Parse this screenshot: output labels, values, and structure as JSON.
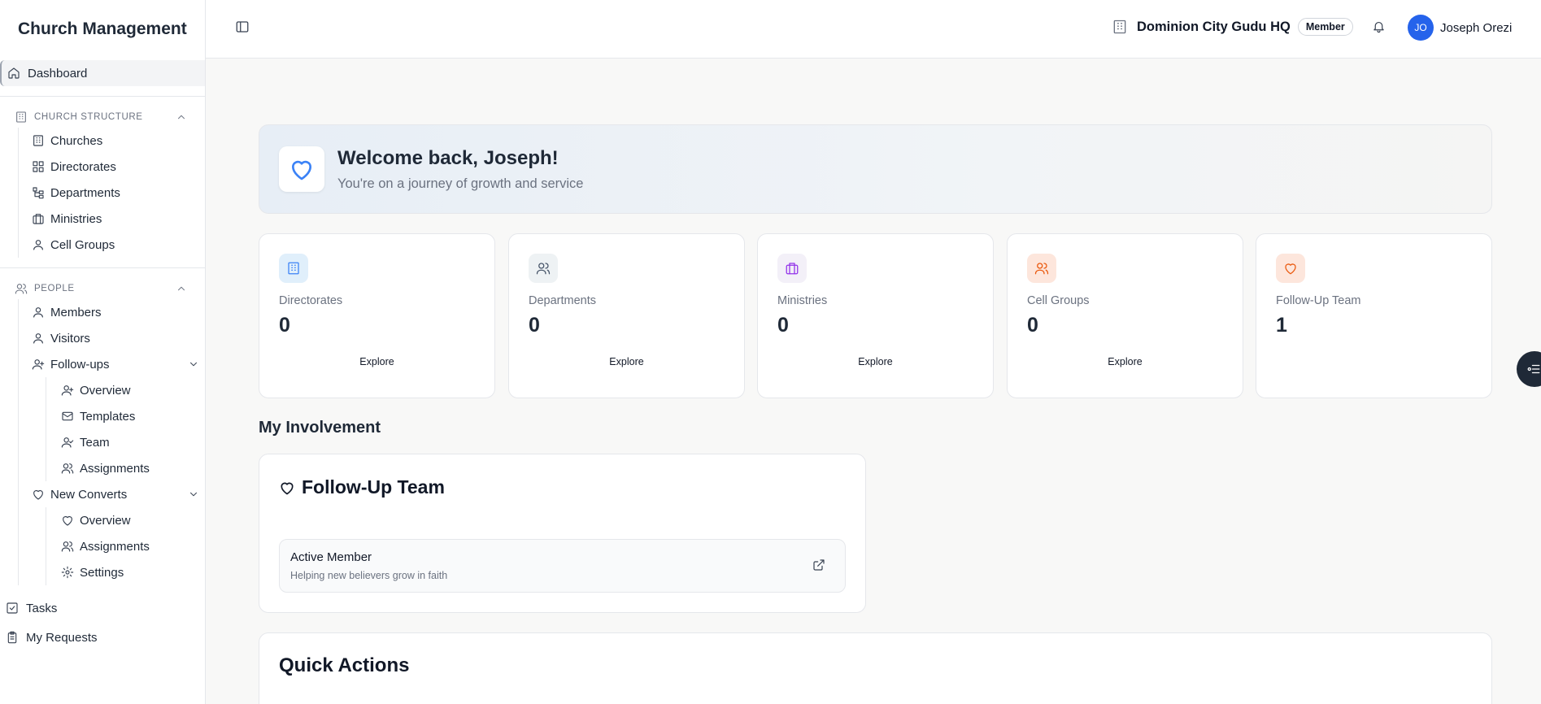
{
  "app": {
    "title": "Church Management"
  },
  "sidebar": {
    "dashboard": "Dashboard",
    "church_structure": {
      "heading": "CHURCH STRUCTURE",
      "items": [
        "Churches",
        "Directorates",
        "Departments",
        "Ministries",
        "Cell Groups"
      ]
    },
    "people": {
      "heading": "PEOPLE",
      "members": "Members",
      "visitors": "Visitors",
      "followups": {
        "label": "Follow-ups",
        "items": [
          "Overview",
          "Templates",
          "Team",
          "Assignments"
        ]
      },
      "new_converts": {
        "label": "New Converts",
        "items": [
          "Overview",
          "Assignments",
          "Settings"
        ]
      }
    },
    "tasks": "Tasks",
    "my_requests": "My Requests"
  },
  "header": {
    "church_name": "Dominion City Gudu HQ",
    "role_badge": "Member",
    "user_initials": "JO",
    "user_name": "Joseph Orezi"
  },
  "welcome": {
    "title": "Welcome back, Joseph!",
    "subtitle": "You're on a journey of growth and service"
  },
  "stats": [
    {
      "label": "Directorates",
      "value": "0",
      "action": "Explore",
      "color": "#3b82f6",
      "bg": "#e0effb",
      "icon": "building-icon"
    },
    {
      "label": "Departments",
      "value": "0",
      "action": "Explore",
      "color": "#475569",
      "bg": "#eef2f4",
      "icon": "users-icon"
    },
    {
      "label": "Ministries",
      "value": "0",
      "action": "Explore",
      "color": "#9333ea",
      "bg": "#f3f0f8",
      "icon": "briefcase-icon"
    },
    {
      "label": "Cell Groups",
      "value": "0",
      "action": "Explore",
      "color": "#ea580c",
      "bg": "#fde6dc",
      "icon": "users-icon"
    },
    {
      "label": "Follow-Up Team",
      "value": "1",
      "action": "",
      "color": "#ea580c",
      "bg": "#fde6dc",
      "icon": "heart-icon"
    }
  ],
  "involvement": {
    "heading": "My Involvement",
    "team_name": "Follow-Up Team",
    "member_title": "Active Member",
    "member_desc": "Helping new believers grow in faith"
  },
  "quick_actions": {
    "title": "Quick Actions"
  }
}
